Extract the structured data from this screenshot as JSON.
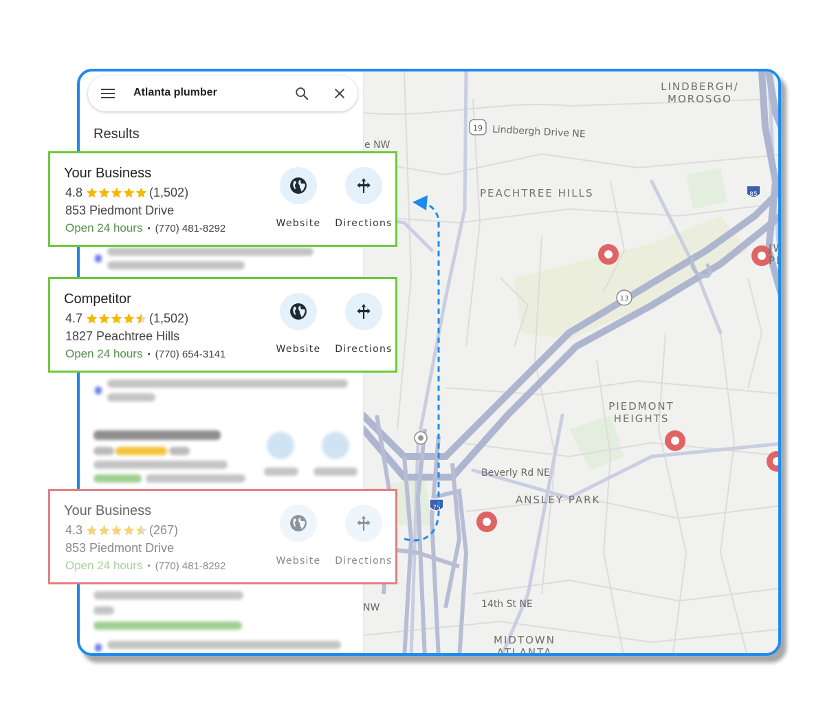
{
  "search": {
    "query": "Atlanta plumber"
  },
  "results_heading": "Results",
  "cards": [
    {
      "name": "Your Business",
      "rating": "4.8",
      "reviews": "(1,502)",
      "stars": 5,
      "address": "853 Piedmont Drive",
      "hours": "Open 24 hours",
      "separator": "•",
      "phone": "(770) 481-8292",
      "website_label": "Website",
      "directions_label": "Directions"
    },
    {
      "name": "Competitor",
      "rating": "4.7",
      "reviews": "(1,502)",
      "stars": 4.5,
      "address": "1827 Peachtree Hills",
      "hours": "Open 24 hours",
      "separator": "•",
      "phone": "(770) 654-3141",
      "website_label": "Website",
      "directions_label": "Directions"
    },
    {
      "name": "Your Business",
      "rating": "4.3",
      "reviews": "(267)",
      "stars": 4.5,
      "address": "853 Piedmont Drive",
      "hours": "Open 24 hours",
      "separator": "•",
      "phone": "(770) 481-8292",
      "website_label": "Website",
      "directions_label": "Directions"
    }
  ],
  "map": {
    "areas": [
      "LINDBERGH/ MOROSGO",
      "PEACHTREE HILLS",
      "PIEDMONT HEIGHTS",
      "ANSLEY PARK",
      "MIDTOWN ATLANTA",
      "JW PI"
    ],
    "streets": [
      "Lindbergh Drive NE",
      "Beverly Rd NE",
      "14th St NE",
      "e NW",
      "NW"
    ],
    "shields": [
      "19",
      "85",
      "13",
      "75"
    ]
  },
  "colors": {
    "frame": "#1a8cf0",
    "highlight_border": "#6bc93a",
    "faded_border": "#e37f7f",
    "hours_green": "#54904a",
    "pin": "#e06464",
    "arrow": "#1a8cf0"
  }
}
